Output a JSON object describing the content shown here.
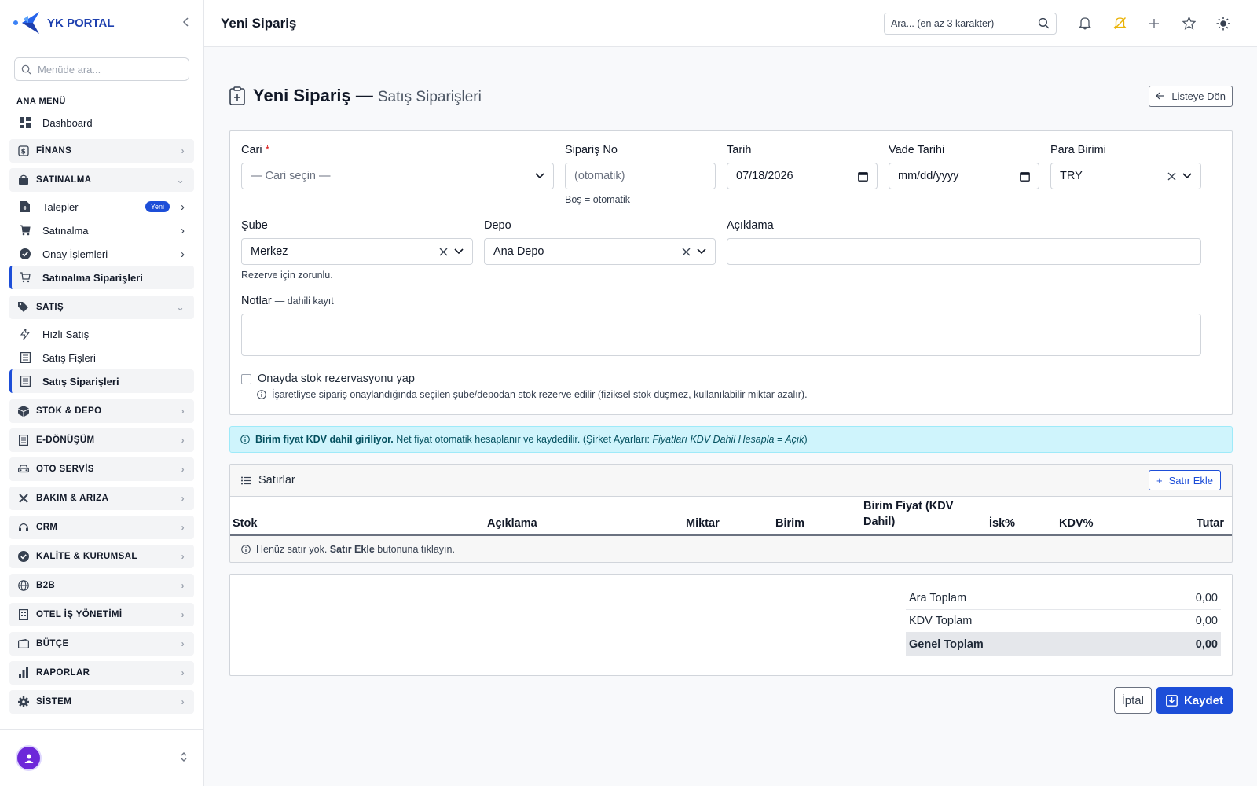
{
  "brand": {
    "name": "YK PORTAL"
  },
  "sidebar": {
    "search_placeholder": "Menüde ara...",
    "heading": "ANA MENÜ",
    "dashboard": "Dashboard",
    "finans": "FİNANS",
    "satinalma": "SATINALMA",
    "satinalma_items": [
      "Talepler",
      "Satınalma",
      "Onay İşlemleri",
      "Satınalma Siparişleri"
    ],
    "badge_new": "Yeni",
    "satis": "SATIŞ",
    "satis_items": [
      "Hızlı Satış",
      "Satış Fişleri",
      "Satış Siparişleri"
    ],
    "groups": [
      "STOK & DEPO",
      "E-DÖNÜŞÜM",
      "OTO SERVİS",
      "BAKIM & ARIZA",
      "CRM",
      "KALİTE & KURUMSAL",
      "B2B",
      "OTEL İŞ YÖNETİMİ",
      "BÜTÇE",
      "RAPORLAR",
      "SİSTEM"
    ]
  },
  "topbar": {
    "title": "Yeni Sipariş",
    "search_placeholder": "Ara... (en az 3 karakter)"
  },
  "page": {
    "title": "Yeni Sipariş —",
    "subtitle": "Satış Siparişleri",
    "back_label": "Listeye Dön"
  },
  "form": {
    "cari_label": "Cari",
    "cari_required": "*",
    "cari_value": "— Cari seçin —",
    "siparis_no_label": "Sipariş No",
    "siparis_no_placeholder": "(otomatik)",
    "siparis_no_help": "Boş = otomatik",
    "tarih_label": "Tarih",
    "tarih_value": "07/18/2026",
    "vade_label": "Vade Tarihi",
    "vade_value": "mm/dd/yyyy",
    "para_label": "Para Birimi",
    "para_value": "TRY",
    "sube_label": "Şube",
    "sube_value": "Merkez",
    "sube_help": "Rezerve için zorunlu.",
    "depo_label": "Depo",
    "depo_value": "Ana Depo",
    "aciklama_label": "Açıklama",
    "notlar_label": "Notlar",
    "notlar_hint": "— dahili kayıt",
    "rezerv_label": "Onayda stok rezervasyonu yap",
    "rezerv_info": "İşaretliyse sipariş onaylandığında seçilen şube/depodan stok rezerve edilir (fiziksel stok düşmez, kullanılabilir miktar azalır)."
  },
  "alert": {
    "bold": "Birim fiyat KDV dahil giriliyor.",
    "text": " Net fiyat otomatik hesaplanır ve kaydedilir. (Şirket Ayarları: ",
    "italic": "Fiyatları KDV Dahil Hesapla = Açık",
    "end": ")"
  },
  "lines": {
    "title": "Satırlar",
    "add_label": "Satır Ekle",
    "columns": [
      "Stok",
      "Açıklama",
      "Miktar",
      "Birim",
      "Birim Fiyat (KDV Dahil)",
      "İsk%",
      "KDV%",
      "Tutar"
    ],
    "empty_pre": "Henüz satır yok. ",
    "empty_bold": "Satır Ekle",
    "empty_post": " butonuna tıklayın."
  },
  "totals": {
    "ara_label": "Ara Toplam",
    "ara_value": "0,00",
    "kdv_label": "KDV Toplam",
    "kdv_value": "0,00",
    "genel_label": "Genel Toplam",
    "genel_value": "0,00"
  },
  "actions": {
    "cancel": "İptal",
    "save": "Kaydet"
  },
  "colors": {
    "primary": "#1d4ed8",
    "alert_bg": "#cff4fc",
    "avatar": "#6d28d9"
  }
}
